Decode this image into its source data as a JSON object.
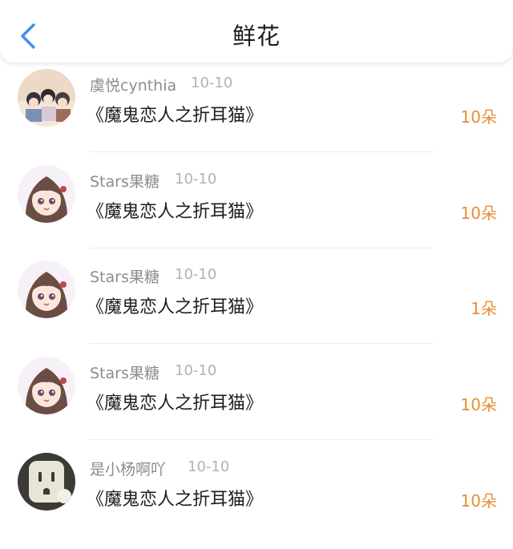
{
  "header": {
    "title": "鲜花"
  },
  "colors": {
    "accent_blue": "#3d8ef0",
    "count_orange": "#ec8c33",
    "username_gray": "#8c8c8c",
    "date_gray": "#b2b2b2"
  },
  "items": [
    {
      "username": "虞悦cynthia",
      "date": "10-10",
      "book": "《魔鬼恋人之折耳猫》",
      "count": "10朵"
    },
    {
      "username": "Stars果糖",
      "date": "10-10",
      "book": "《魔鬼恋人之折耳猫》",
      "count": "10朵"
    },
    {
      "username": "Stars果糖",
      "date": "10-10",
      "book": "《魔鬼恋人之折耳猫》",
      "count": "1朵"
    },
    {
      "username": "Stars果糖",
      "date": "10-10",
      "book": "《魔鬼恋人之折耳猫》",
      "count": "10朵"
    },
    {
      "username": "是小杨啊吖",
      "date": "10-10",
      "book": "《魔鬼恋人之折耳猫》",
      "count": "10朵"
    }
  ]
}
